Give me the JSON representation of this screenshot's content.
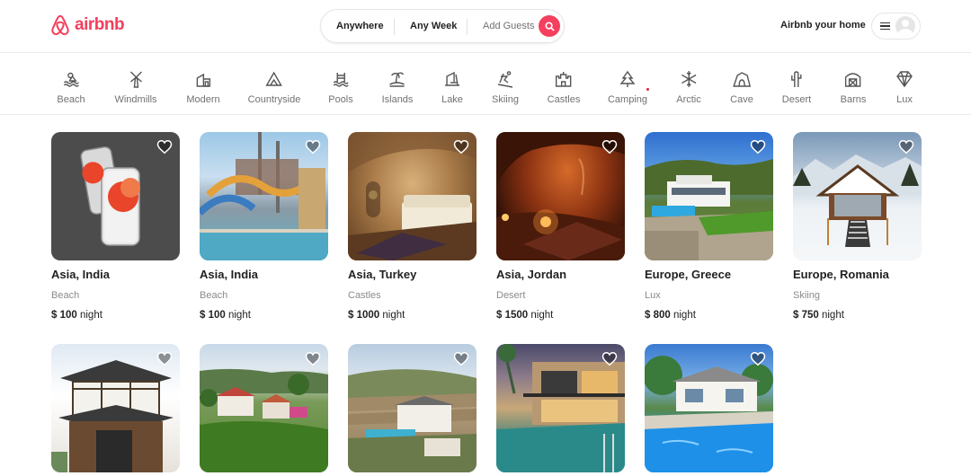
{
  "brand": {
    "name": "airbnb",
    "color": "#f43f5e"
  },
  "search": {
    "anywhere": "Anywhere",
    "week": "Any Week",
    "guests": "Add Guests"
  },
  "header": {
    "host_link": "Airbnb your home"
  },
  "categories": [
    {
      "label": "Beach",
      "icon": "beach-icon"
    },
    {
      "label": "Windmills",
      "icon": "windmill-icon"
    },
    {
      "label": "Modern",
      "icon": "modern-house-icon"
    },
    {
      "label": "Countryside",
      "icon": "mountain-icon"
    },
    {
      "label": "Pools",
      "icon": "pool-icon"
    },
    {
      "label": "Islands",
      "icon": "island-icon"
    },
    {
      "label": "Lake",
      "icon": "lake-icon"
    },
    {
      "label": "Skiing",
      "icon": "skiing-icon"
    },
    {
      "label": "Castles",
      "icon": "castle-icon"
    },
    {
      "label": "Camping",
      "icon": "tree-icon"
    },
    {
      "label": "Arctic",
      "icon": "snowflake-icon"
    },
    {
      "label": "Cave",
      "icon": "cave-icon"
    },
    {
      "label": "Desert",
      "icon": "cactus-icon"
    },
    {
      "label": "Barns",
      "icon": "barn-icon"
    },
    {
      "label": "Lux",
      "icon": "diamond-icon"
    }
  ],
  "listings": [
    {
      "location": "Asia, India",
      "category": "Beach",
      "price": "$ 100",
      "unit": "night",
      "image": "phone-product-photo"
    },
    {
      "location": "Asia, India",
      "category": "Beach",
      "price": "$ 100",
      "unit": "night",
      "image": "water-park-photo"
    },
    {
      "location": "Asia, Turkey",
      "category": "Castles",
      "price": "$ 1000",
      "unit": "night",
      "image": "cave-bedroom-photo"
    },
    {
      "location": "Asia, Jordan",
      "category": "Desert",
      "price": "$ 1500",
      "unit": "night",
      "image": "desert-cave-camp-photo"
    },
    {
      "location": "Europe, Greece",
      "category": "Lux",
      "price": "$ 800",
      "unit": "night",
      "image": "greek-villa-photo"
    },
    {
      "location": "Europe, Romania",
      "category": "Skiing",
      "price": "$ 750",
      "unit": "night",
      "image": "snow-cabin-photo"
    },
    {
      "image": "japanese-house-photo"
    },
    {
      "image": "countryside-homes-photo"
    },
    {
      "image": "terraced-villa-photo"
    },
    {
      "image": "modern-pool-house-photo"
    },
    {
      "image": "tropical-pool-villa-photo"
    }
  ]
}
